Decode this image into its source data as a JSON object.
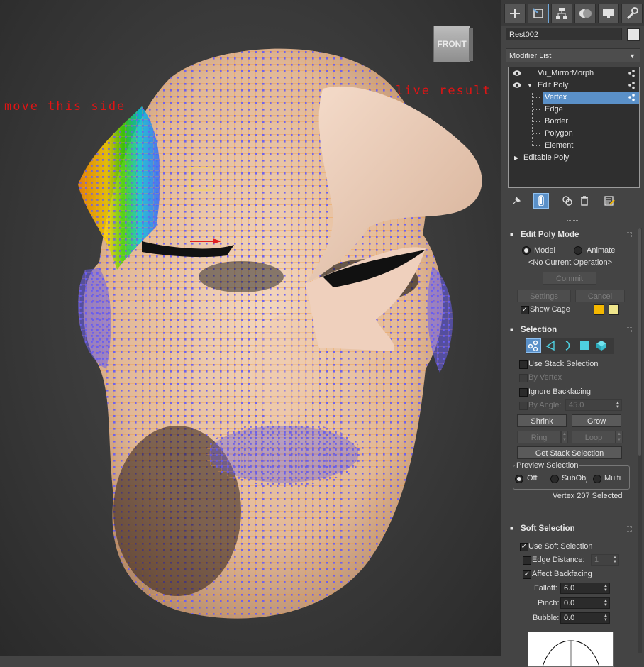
{
  "viewport": {
    "annotation_left": "move this side",
    "annotation_right": "live result",
    "viewcube_label": "FRONT"
  },
  "command_panel": {
    "tabs": [
      "create-icon",
      "modify-icon",
      "hierarchy-icon",
      "motion-icon",
      "display-icon",
      "utilities-icon"
    ],
    "object_name": "Rest002",
    "object_color": "#e5e5e5",
    "modifier_list_label": "Modifier List",
    "stack": {
      "items": [
        {
          "label": "Vu_MirrorMorph"
        },
        {
          "label": "Edit Poly"
        },
        {
          "label": "Vertex",
          "selected": true
        },
        {
          "label": "Edge"
        },
        {
          "label": "Border"
        },
        {
          "label": "Polygon"
        },
        {
          "label": "Element"
        },
        {
          "label": "Editable Poly"
        }
      ]
    },
    "edit_poly_mode": {
      "title": "Edit Poly Mode",
      "model_label": "Model",
      "animate_label": "Animate",
      "current_operation": "<No Current Operation>",
      "commit_label": "Commit",
      "settings_label": "Settings",
      "cancel_label": "Cancel",
      "show_cage_label": "Show Cage",
      "cage_colors": [
        "#f5b800",
        "#f0e68c"
      ]
    },
    "selection": {
      "title": "Selection",
      "use_stack_selection": "Use Stack Selection",
      "by_vertex": "By Vertex",
      "ignore_backfacing": "Ignore Backfacing",
      "by_angle_label": "By Angle:",
      "by_angle_value": "45.0",
      "shrink_label": "Shrink",
      "grow_label": "Grow",
      "ring_label": "Ring",
      "loop_label": "Loop",
      "get_stack_selection": "Get Stack Selection",
      "preview_selection_label": "Preview Selection",
      "preview_off": "Off",
      "preview_subobj": "SubObj",
      "preview_multi": "Multi",
      "status": "Vertex 207 Selected"
    },
    "soft_selection": {
      "title": "Soft Selection",
      "use_soft_selection": "Use Soft Selection",
      "edge_distance_label": "Edge Distance:",
      "edge_distance_value": "1",
      "affect_backfacing": "Affect Backfacing",
      "falloff_label": "Falloff:",
      "falloff_value": "6.0",
      "pinch_label": "Pinch:",
      "pinch_value": "0.0",
      "bubble_label": "Bubble:",
      "bubble_value": "0.0"
    }
  }
}
